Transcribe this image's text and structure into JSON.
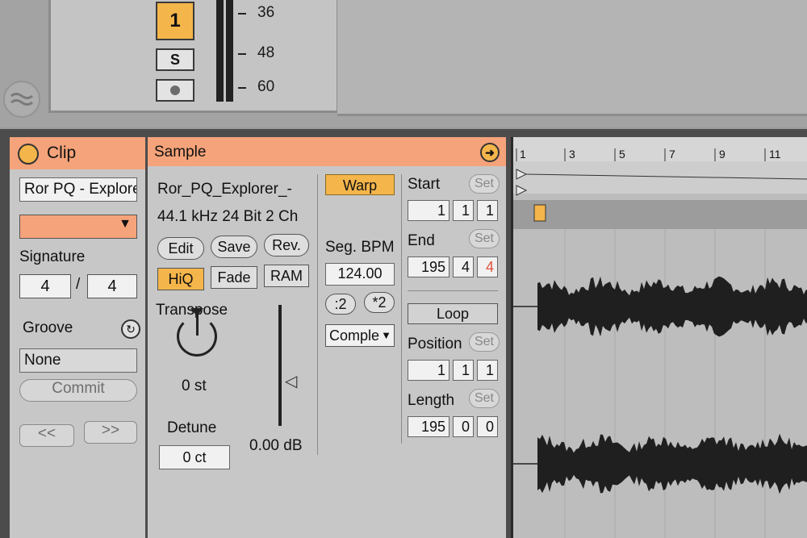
{
  "mixer": {
    "track_number": "1",
    "solo_label": "S",
    "meter_scale": [
      "36",
      "48",
      "60"
    ]
  },
  "clip": {
    "title": "Clip",
    "name_value": "Ror PQ - Explorer",
    "color": "#f5a37a",
    "signature_label": "Signature",
    "signature_numerator": "4",
    "signature_separator": "/",
    "signature_denominator": "4",
    "groove_label": "Groove",
    "groove_value": "None",
    "commit_label": "Commit",
    "nudge_back_label": "<<",
    "nudge_forward_label": ">>"
  },
  "sample": {
    "title": "Sample",
    "file_name": "Ror_PQ_Explorer_-",
    "file_info": "44.1 kHz 24 Bit 2 Ch",
    "edit_label": "Edit",
    "save_label": "Save",
    "rev_label": "Rev.",
    "hiq_label": "HiQ",
    "fade_label": "Fade",
    "ram_label": "RAM",
    "transpose_label": "Transpose",
    "transpose_value": "0 st",
    "detune_label": "Detune",
    "detune_value": "0 ct",
    "gain_value": "0.00 dB",
    "warp_label": "Warp",
    "seg_bpm_label": "Seg. BPM",
    "seg_bpm_value": "124.00",
    "half_label": ":2",
    "double_label": "*2",
    "warp_mode": "Comple"
  },
  "markers": {
    "start_label": "Start",
    "start_values": [
      "1",
      "1",
      "1"
    ],
    "end_label": "End",
    "end_values": [
      "195",
      "4",
      "4"
    ],
    "set_label": "Set",
    "loop_label": "Loop",
    "position_label": "Position",
    "position_values": [
      "1",
      "1",
      "1"
    ],
    "length_label": "Length",
    "length_values": [
      "195",
      "0",
      "0"
    ]
  },
  "timeline": {
    "bars": [
      "1",
      "3",
      "5",
      "7",
      "9",
      "11"
    ]
  },
  "colors": {
    "accent_orange": "#f4b54a",
    "clip_salmon": "#f5a37a",
    "end_highlight": "#e0523f"
  }
}
